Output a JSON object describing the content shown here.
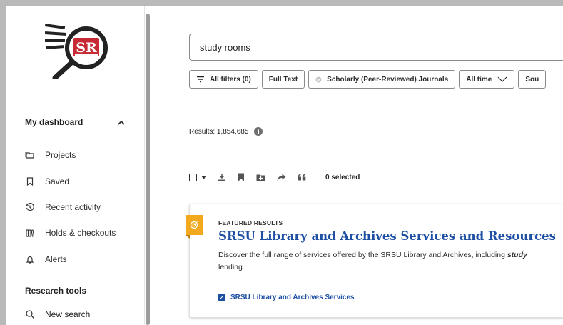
{
  "sidebar": {
    "logo_text": "SR",
    "dashboard_label": "My dashboard",
    "nav": [
      {
        "label": "Projects",
        "icon": "folder-icon"
      },
      {
        "label": "Saved",
        "icon": "bookmark-icon"
      },
      {
        "label": "Recent activity",
        "icon": "history-icon"
      },
      {
        "label": "Holds & checkouts",
        "icon": "books-icon"
      },
      {
        "label": "Alerts",
        "icon": "bell-icon"
      }
    ],
    "research_tools_label": "Research tools",
    "new_search_label": "New search"
  },
  "search": {
    "query": "study rooms"
  },
  "filters": {
    "all_filters": "All filters (0)",
    "full_text": "Full Text",
    "scholarly": "Scholarly (Peer-Reviewed) Journals",
    "time": "All time",
    "source_partial": "Sou"
  },
  "results": {
    "count_text": "Results: 1,854,685",
    "selected_text": "0 selected"
  },
  "featured": {
    "label": "FEATURED RESULTS",
    "title": "SRSU Library and Archives Services and Resources",
    "desc_before": "Discover the full range of services offered by the SRSU Library and Archives, including ",
    "desc_em": "study",
    "desc_after": "lending.",
    "link": "SRSU Library and Archives Services"
  },
  "colors": {
    "accent": "#1d4fa3",
    "logo_red": "#c62b35",
    "featured_badge": "#f2a91e"
  }
}
